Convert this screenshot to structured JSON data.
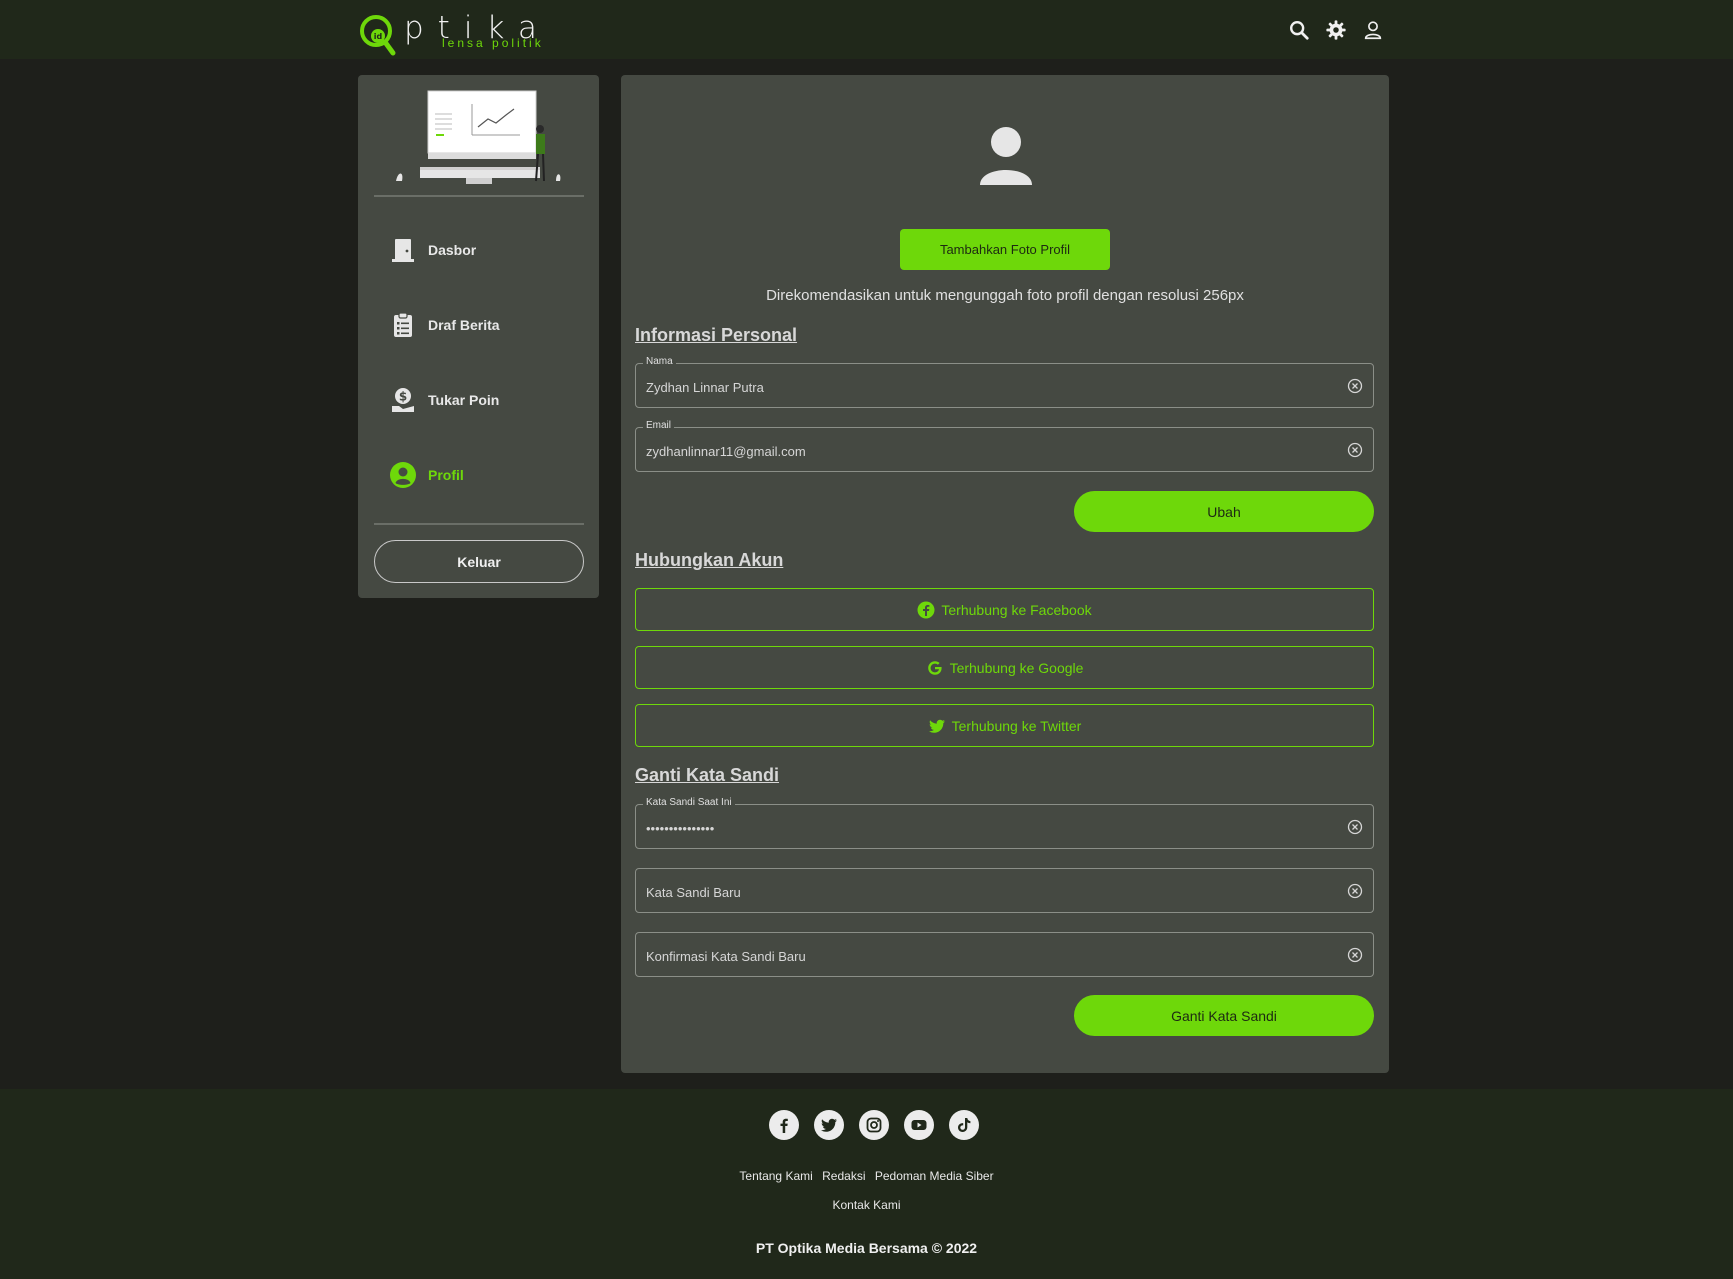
{
  "brand": {
    "logo_word": "ptika",
    "tagline": "lensa politik",
    "mark_text": "id",
    "accent": "#6ed80a"
  },
  "header": {
    "icons": [
      "search-icon",
      "gear-icon",
      "user-icon"
    ]
  },
  "sidebar": {
    "items": [
      {
        "label": "Dasbor",
        "icon": "door-icon",
        "active": false
      },
      {
        "label": "Draf Berita",
        "icon": "clipboard-icon",
        "active": false
      },
      {
        "label": "Tukar Poin",
        "icon": "coin-hand-icon",
        "active": false
      },
      {
        "label": "Profil",
        "icon": "user-circle-icon",
        "active": true
      }
    ],
    "logout_label": "Keluar"
  },
  "profile": {
    "add_photo_label": "Tambahkan Foto Profil",
    "recommend_text": "Direkomendasikan untuk mengunggah foto profil dengan resolusi 256px",
    "personal_title": "Informasi Personal",
    "name_label": "Nama",
    "name_value": "Zydhan Linnar Putra",
    "email_label": "Email",
    "email_value": "zydhanlinnar11@gmail.com",
    "save_label": "Ubah"
  },
  "connect": {
    "title": "Hubungkan Akun",
    "facebook_label": "Terhubung ke Facebook",
    "google_label": "Terhubung ke Google",
    "twitter_label": "Terhubung ke Twitter"
  },
  "password": {
    "title": "Ganti Kata Sandi",
    "current_label": "Kata Sandi Saat Ini",
    "current_value": "•••••••••••••••",
    "new_placeholder": "Kata Sandi Baru",
    "confirm_placeholder": "Konfirmasi Kata Sandi Baru",
    "submit_label": "Ganti Kata Sandi"
  },
  "footer": {
    "social_icons": [
      "facebook-icon",
      "twitter-icon",
      "instagram-icon",
      "youtube-icon",
      "tiktok-icon"
    ],
    "links": [
      "Tentang Kami",
      "Redaksi",
      "Pedoman Media Siber"
    ],
    "link_contact": "Kontak Kami",
    "copyright": "PT Optika Media Bersama © 2022"
  }
}
